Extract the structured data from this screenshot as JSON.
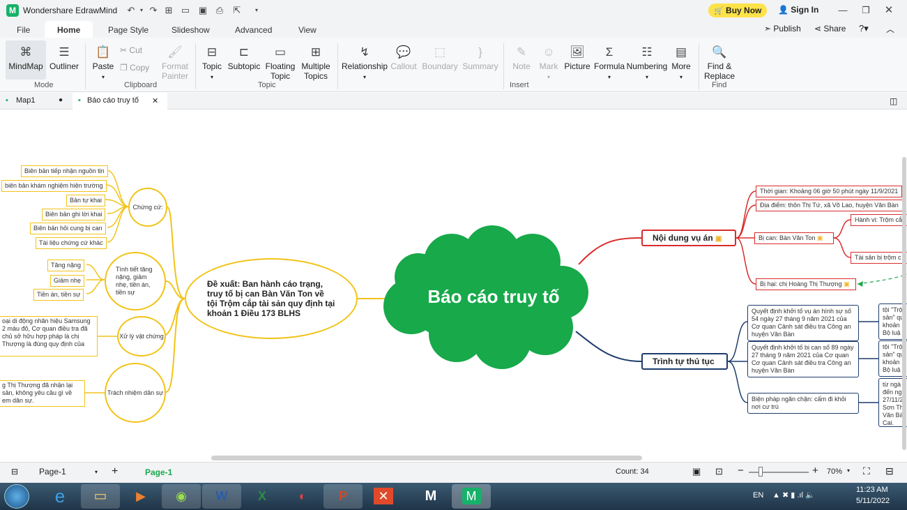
{
  "app": {
    "title": "Wondershare EdrawMind",
    "buy_now": "Buy Now",
    "sign_in": "Sign In"
  },
  "menu_tabs": [
    "File",
    "Home",
    "Page Style",
    "Slideshow",
    "Advanced",
    "View"
  ],
  "share": {
    "publish": "Publish",
    "share": "Share"
  },
  "ribbon": {
    "mode": {
      "mindmap": "MindMap",
      "outliner": "Outliner",
      "group": "Mode"
    },
    "clipboard": {
      "paste": "Paste",
      "cut": "Cut",
      "copy": "Copy",
      "format_painter_1": "Format",
      "format_painter_2": "Painter",
      "group": "Clipboard"
    },
    "topic": {
      "topic": "Topic",
      "subtopic": "Subtopic",
      "floating_1": "Floating",
      "floating_2": "Topic",
      "multiple_1": "Multiple",
      "multiple_2": "Topics",
      "group": "Topic"
    },
    "insert": {
      "relationship": "Relationship",
      "callout": "Callout",
      "boundary": "Boundary",
      "summary": "Summary",
      "note": "Note",
      "mark": "Mark",
      "picture": "Picture",
      "formula": "Formula",
      "numbering": "Numbering",
      "more": "More",
      "group": "Insert"
    },
    "find": {
      "find_1": "Find &",
      "find_2": "Replace",
      "group": "Find"
    }
  },
  "doc_tabs": [
    {
      "label": "Map1"
    },
    {
      "label": "Báo cáo truy tố"
    }
  ],
  "mindmap": {
    "central": "Báo cáo truy tố",
    "left_main": "Đề xuất: Ban hành cáo trạng, truy tố bị can Bàn Văn Ton về tội Trộm cắp tài sản quy định tại khoản 1 Điều 173 BLHS",
    "chung_cu": {
      "label": "Chứng cứ:",
      "items": [
        "Biên bản tiếp nhận nguồn tin",
        "biên bản khám nghiệm hiện trường",
        "Bản tự khai",
        "Biên bản ghi lời khai",
        "Biên bản hỏi cung bị can",
        "Tài liệu chứng cứ khác"
      ]
    },
    "tinh_tiet": {
      "label": "Tình tiết tăng nặng, giảm nhẹ, tiền án, tiền sự",
      "items": [
        "Tăng nặng",
        "Giảm nhẹ",
        "Tiền án, tiền sự"
      ]
    },
    "xu_ly": {
      "label": "Xử lý vật chứng",
      "text": "oại di động nhãn hiệu Samsung 2 màu đỏ, Cơ quan điều tra đã chủ sở hữu hợp pháp là chị Thượng là đúng quy định của"
    },
    "trach_nhiem": {
      "label": "Trách nhiệm dân sự",
      "text": "g Thị Thượng đã nhận lại sản, không yêu cầu gì về em dân sự."
    },
    "noi_dung": {
      "label": "Nội dung vụ án",
      "items": [
        "Thời gian: Khoảng 06 giờ 50 phút ngày 11/9/2021",
        "Địa điểm: thôn Thị Tứ, xã Võ Lao, huyện Văn Bàn",
        "Bị can: Bàn Văn Ton",
        "Bị hại: chị Hoàng Thị Thượng"
      ],
      "sub": [
        "Hành vi: Trộm cắ",
        "Tài sản bị trộm c"
      ]
    },
    "trinh_tu": {
      "label": "Trình tự thủ tục",
      "items": [
        "Quyết định khởi tố vụ án hình sự số 54 ngày 27 tháng 9 năm 2021 của Cơ quan Cảnh sát điều tra Công an huyện Văn Bàn",
        "Quyết định khởi tố bị can số 89 ngày 27 tháng 9 năm 2021 của Cơ quan Cơ quan Cảnh sát điều tra Công an huyện Văn Bàn",
        "Biện pháp ngăn chặn: cấm đi khỏi nơi cư trú"
      ],
      "sub": [
        "tội \"Trộ sản\" qu khoản Bộ luậ",
        "tội \"Trộ sản\" qu khoản Bộ luậ",
        "từ ngà đến ng 27/11/2 Sơn Th Văn Bà Cai."
      ]
    }
  },
  "status": {
    "page_select": "Page-1",
    "page_tab": "Page-1",
    "count": "Count: 34",
    "zoom": "70%"
  },
  "taskbar": {
    "lang": "EN",
    "time": "11:23 AM",
    "date": "5/11/2022"
  },
  "colors": {
    "central": "#17a94a",
    "yellow": "#f2c318",
    "red": "#d92b2b",
    "navy": "#1d3b6b",
    "brand": "#17b26a"
  }
}
